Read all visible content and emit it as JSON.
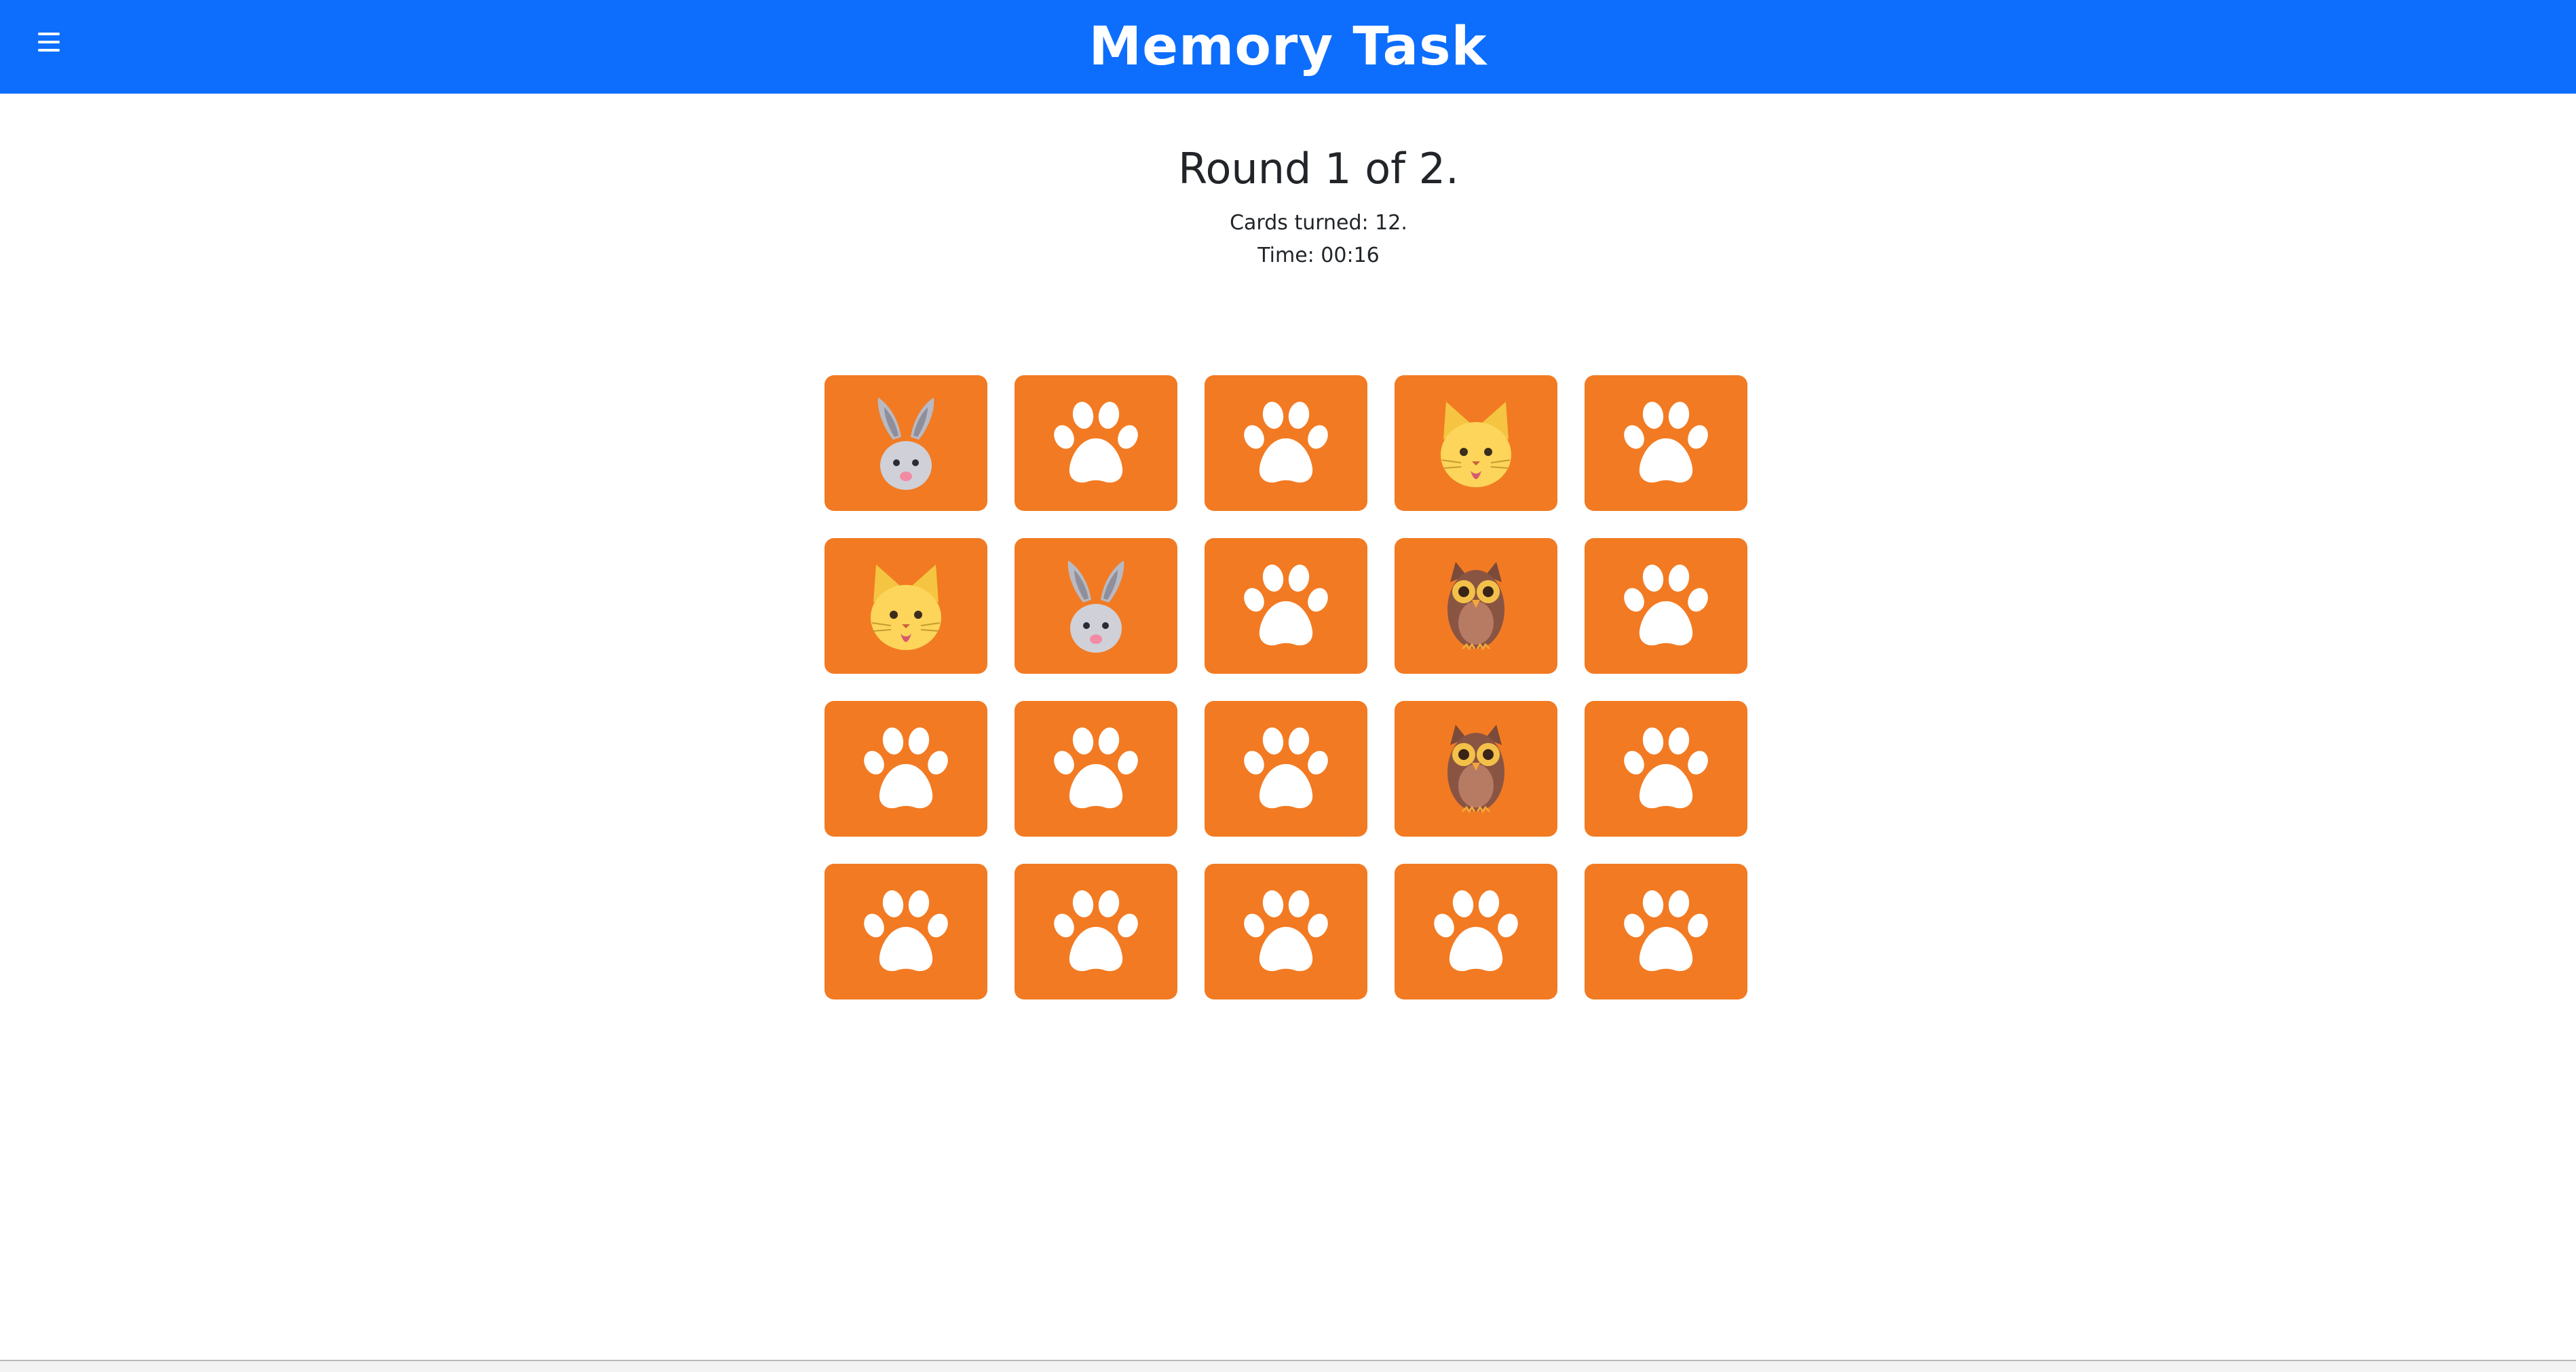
{
  "header": {
    "title": "Memory Task",
    "menu_icon": "hamburger-menu-icon"
  },
  "game": {
    "round_text": "Round 1 of 2.",
    "cards_turned": "Cards turned: 12.",
    "time": "Time: 00:16"
  },
  "cards": [
    "rabbit",
    "paw",
    "paw",
    "cat",
    "paw",
    "cat",
    "rabbit",
    "paw",
    "owl",
    "paw",
    "paw",
    "paw",
    "paw",
    "owl",
    "paw",
    "paw",
    "paw",
    "paw",
    "paw",
    "paw"
  ],
  "colors": {
    "navbar": "#0d6efd",
    "card": "#f27a22",
    "paw": "#ffffff"
  }
}
